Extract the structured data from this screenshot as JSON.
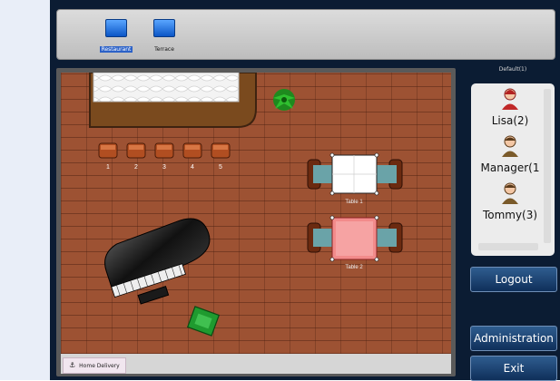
{
  "areas": [
    {
      "label": "Restaurant",
      "active": true
    },
    {
      "label": "Terrace",
      "active": false
    }
  ],
  "floor": {
    "bar_stools": [
      "1",
      "2",
      "3",
      "4",
      "5"
    ],
    "tables": [
      {
        "label": "Table 1",
        "color": "#ffffff"
      },
      {
        "label": "Table 2",
        "color": "#f28b8b"
      }
    ]
  },
  "status": {
    "tab_label": "Home Delivery"
  },
  "sidebar": {
    "title": "Default(1)",
    "users": [
      {
        "name": "Lisa(2)",
        "icon": "female-user-icon"
      },
      {
        "name": "Manager(1",
        "icon": "male-user-icon"
      },
      {
        "name": "Tommy(3)",
        "icon": "male-user-icon"
      }
    ]
  },
  "buttons": {
    "logout": "Logout",
    "administration": "Administration",
    "exit": "Exit"
  },
  "colors": {
    "floor": "#9d5233",
    "panel_bg": "#0b1c33",
    "button": "#1f4a7d"
  }
}
